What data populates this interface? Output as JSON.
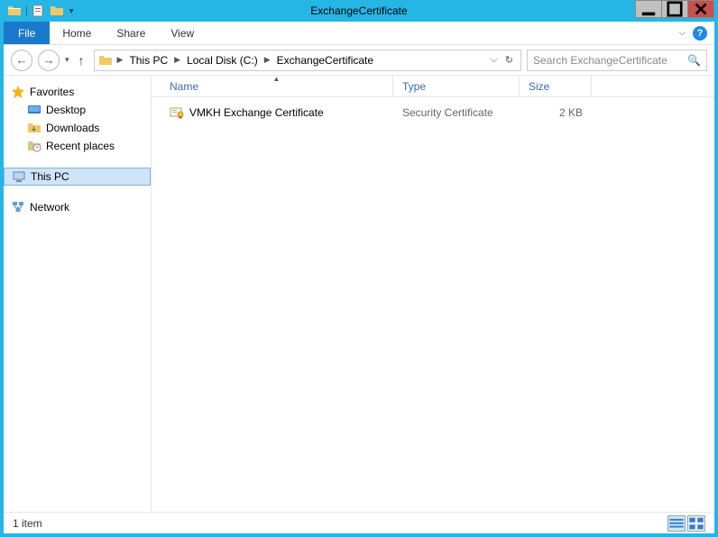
{
  "window": {
    "title": "ExchangeCertificate"
  },
  "ribbon": {
    "file": "File",
    "tabs": [
      "Home",
      "Share",
      "View"
    ]
  },
  "breadcrumbs": [
    "This PC",
    "Local Disk (C:)",
    "ExchangeCertificate"
  ],
  "search": {
    "placeholder": "Search ExchangeCertificate"
  },
  "sidebar": {
    "favorites": {
      "label": "Favorites",
      "items": [
        "Desktop",
        "Downloads",
        "Recent places"
      ]
    },
    "thispc": "This PC",
    "network": "Network"
  },
  "columns": {
    "name": "Name",
    "type": "Type",
    "size": "Size"
  },
  "files": [
    {
      "name": "VMKH Exchange Certificate",
      "type": "Security Certificate",
      "size": "2 KB"
    }
  ],
  "status": {
    "count": "1 item"
  }
}
